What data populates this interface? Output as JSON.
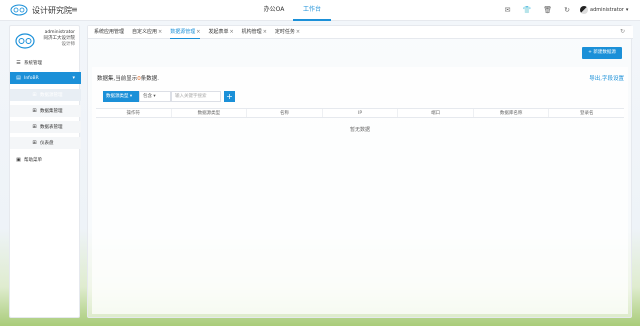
{
  "app": {
    "brand": "设计研究院",
    "menu_icon": "hamburger-icon"
  },
  "topnav": {
    "items": [
      {
        "label": "办公OA",
        "active": false
      },
      {
        "label": "工作台",
        "active": true
      }
    ]
  },
  "top_icons": [
    "mail-icon",
    "shirt-icon",
    "trash-icon",
    "refresh-icon"
  ],
  "user": {
    "name": "administrator",
    "caret_icon": "caret-down-icon"
  },
  "sidebar": {
    "profile": {
      "username": "administrator",
      "org": "同济工大设计院",
      "role": "设计师"
    },
    "items": [
      {
        "label": "系统管理",
        "icon": "list-icon",
        "active": false,
        "sub": false
      },
      {
        "label": "InfoBR",
        "icon": "folder-icon",
        "active": true,
        "sub": false
      },
      {
        "label": "数据源管理",
        "icon": "grid-icon",
        "active": true,
        "sub": true
      },
      {
        "label": "数据集管理",
        "icon": "grid-icon",
        "active": false,
        "sub": true
      },
      {
        "label": "数据表管理",
        "icon": "grid-icon",
        "active": false,
        "sub": true
      },
      {
        "label": "仪表盘",
        "icon": "grid-icon",
        "active": false,
        "sub": true
      },
      {
        "label": "帮助菜单",
        "icon": "help-icon",
        "active": false,
        "sub": false
      }
    ]
  },
  "tabs": [
    {
      "label": "系统应用管理",
      "closable": false,
      "active": false
    },
    {
      "label": "自定义应用",
      "closable": true,
      "active": false
    },
    {
      "label": "数据源管理",
      "closable": true,
      "active": true
    },
    {
      "label": "发起表单",
      "closable": true,
      "active": false
    },
    {
      "label": "机构管理",
      "closable": true,
      "active": false
    },
    {
      "label": "定时任务",
      "closable": true,
      "active": false
    }
  ],
  "tab_close_glyph": "×",
  "main": {
    "add_button": "+ 新建数据源",
    "summary_prefix": "数据集,当前显示",
    "summary_count": "0",
    "summary_suffix": "条数据.",
    "export_link": "导出,字段设置",
    "search": {
      "field_select": "数据源类型 ▾",
      "operator_select": "包含 ▾",
      "placeholder": "输入关键字搜索",
      "add_glyph": "+"
    },
    "columns": [
      "操作符",
      "数据源类型",
      "名称",
      "IP",
      "端口",
      "数据库名称",
      "登录名"
    ],
    "empty_text": "暂无数据"
  },
  "colors": {
    "accent": "#1b90d8",
    "count_highlight": "#e0651e"
  }
}
